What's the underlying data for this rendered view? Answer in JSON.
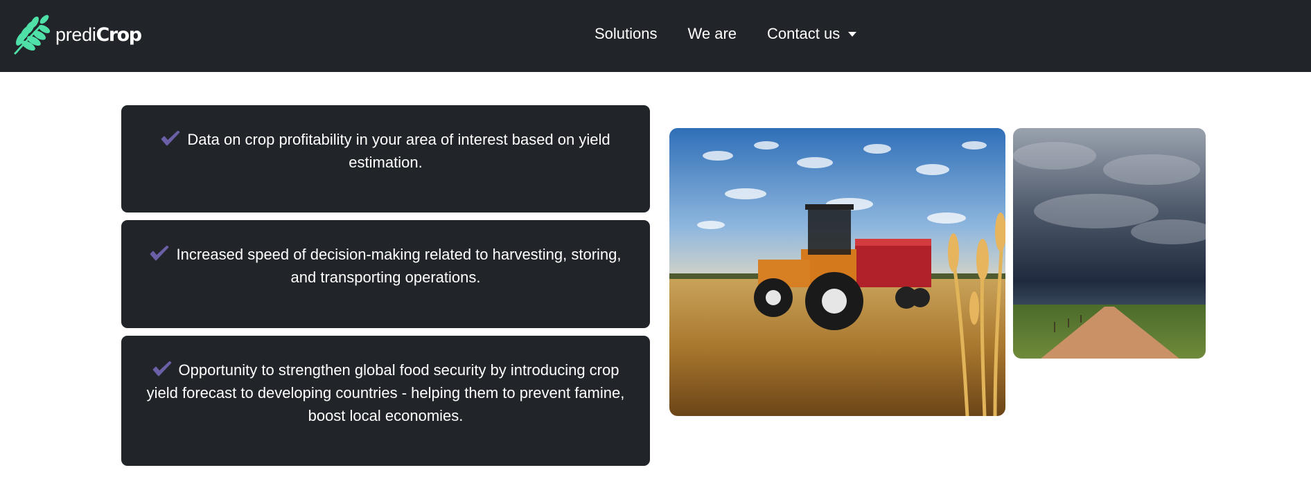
{
  "brand": {
    "name_prefix": "predi",
    "name_suffix": "Crop",
    "logo_icon": "wheat-leaf-icon",
    "accent_color": "#4fe0a8"
  },
  "nav": {
    "items": [
      {
        "label": "Solutions"
      },
      {
        "label": "We are"
      },
      {
        "label": "Contact us",
        "icon": "caret-down-icon"
      }
    ]
  },
  "features": {
    "check_icon": "checkmark-icon",
    "check_color": "#6b5fa8",
    "items": [
      {
        "text": "Data on crop profitability in your area of interest based on yield estimation."
      },
      {
        "text": "Increased speed of decision-making related to harvesting, storing, and transporting operations."
      },
      {
        "text": "Opportunity to strengthen global food security by introducing crop yield forecast to developing countries - helping them to prevent famine, boost local economies."
      }
    ]
  },
  "images": [
    {
      "subject": "tractor-in-wheat-field-photo"
    },
    {
      "subject": "storm-clouds-over-dirt-road-photo"
    }
  ]
}
